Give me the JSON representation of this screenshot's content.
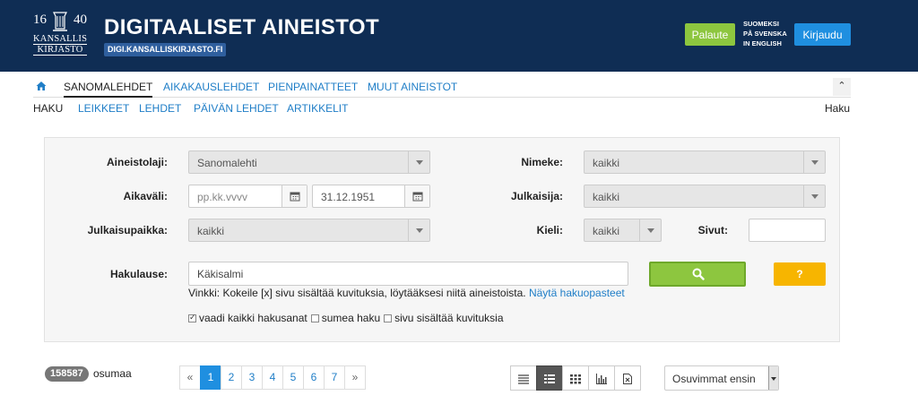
{
  "header": {
    "logo_year_left": "16",
    "logo_year_right": "40",
    "logo_line1": "KANSALLIS",
    "logo_line2": "KIRJASTO",
    "title": "DIGITAALISET AINEISTOT",
    "url": "DIGI.KANSALLISKIRJASTO.FI",
    "feedback_label": "Palaute",
    "languages": [
      "SUOMEKSI",
      "PÅ SVENSKA",
      "IN ENGLISH"
    ],
    "login_label": "Kirjaudu"
  },
  "nav": {
    "tabs": [
      "SANOMALEHDET",
      "AIKAKAUSLEHDET",
      "PIENPAINATTEET",
      "MUUT AINEISTOT"
    ],
    "collapse_glyph": "⌃",
    "sub_current": "HAKU",
    "sub_items": [
      "LEIKKEET",
      "LEHDET",
      "PÄIVÄN LEHDET",
      "ARTIKKELIT"
    ],
    "right_label": "Haku"
  },
  "search": {
    "aineistolaji_label": "Aineistolaji:",
    "aineistolaji_value": "Sanomalehti",
    "nimeke_label": "Nimeke:",
    "nimeke_value": "kaikki",
    "aikavali_label": "Aikaväli:",
    "date_from_placeholder": "pp.kk.vvvv",
    "date_to_value": "31.12.1951",
    "julkaisija_label": "Julkaisija:",
    "julkaisija_value": "kaikki",
    "julkaisupaikka_label": "Julkaisupaikka:",
    "julkaisupaikka_value": "kaikki",
    "kieli_label": "Kieli:",
    "kieli_value": "kaikki",
    "sivut_label": "Sivut:",
    "sivut_value": "",
    "hakulause_label": "Hakulause:",
    "hakulause_value": "Käkisalmi",
    "help_label": "?",
    "tip_text": "Vinkki: Kokeile [x] sivu sisältää kuvituksia, löytääksesi niitä aineistoista.",
    "tip_link": "Näytä hakuopasteet",
    "check1": "vaadi kaikki hakusanat",
    "check2": "sumea haku",
    "check3": "sivu sisältää kuvituksia"
  },
  "results": {
    "count": "158587",
    "count_label": "osumaa",
    "pages": [
      "«",
      "1",
      "2",
      "3",
      "4",
      "5",
      "6",
      "7",
      "»"
    ],
    "sort_value": "Osuvimmat ensin"
  }
}
